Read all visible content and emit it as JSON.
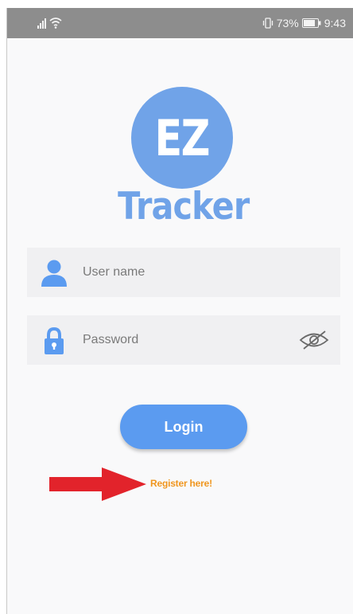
{
  "status_bar": {
    "battery_percent": "73%",
    "time": "9:43",
    "icons": [
      "signal-icon",
      "wifi-icon",
      "vibrate-icon",
      "battery-icon"
    ]
  },
  "logo": {
    "badge": "EZ",
    "name": "Tracker"
  },
  "form": {
    "username_placeholder": "User name",
    "password_placeholder": "Password",
    "login_label": "Login",
    "register_label": "Register here!"
  },
  "colors": {
    "brand_blue": "#70a3e8",
    "button_blue": "#5b9bf0",
    "register_orange": "#f0961e",
    "arrow_red": "#e2232b"
  }
}
